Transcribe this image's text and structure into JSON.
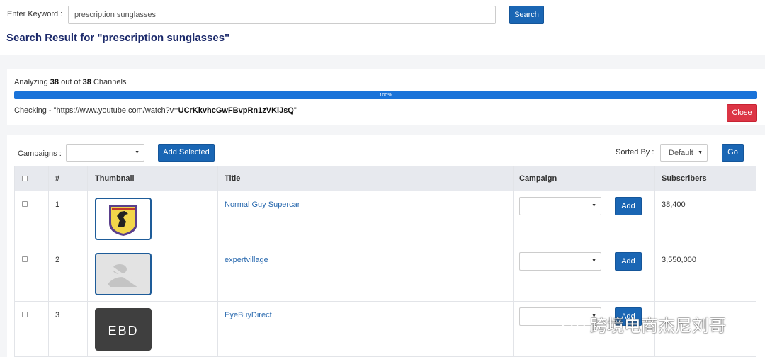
{
  "search": {
    "label": "Enter Keyword :",
    "value": "prescription sunglasses",
    "button": "Search",
    "result_title": "Search Result for \"prescription sunglasses\""
  },
  "progress": {
    "analyzing_prefix": "Analyzing",
    "analyzed": "38",
    "out_of": "out of",
    "total": "38",
    "suffix": "Channels",
    "percent_label": "100%",
    "percent": 100,
    "checking_prefix": "Checking - \"https://www.youtube.com/watch?v=",
    "checking_id": "UCrKkvhcGwFBvpRn1zVKiJsQ",
    "checking_suffix": "\"",
    "close": "Close",
    "bar_color": "#1a73d9",
    "close_color": "#dc3545"
  },
  "toolbar": {
    "campaigns_label": "Campaigns :",
    "campaigns_value": "",
    "add_selected": "Add Selected",
    "sorted_label": "Sorted By :",
    "sort_value": "Default",
    "go": "Go"
  },
  "table": {
    "headers": [
      "#",
      "Thumbnail",
      "Title",
      "Campaign",
      "Subscribers"
    ],
    "add_label": "Add",
    "rows": [
      {
        "num": "1",
        "title": "Normal Guy Supercar",
        "subscribers": "38,400",
        "thumb_icon": "prancing-horse-logo-icon"
      },
      {
        "num": "2",
        "title": "expertvillage",
        "subscribers": "3,550,000",
        "thumb_icon": "default-avatar-icon"
      },
      {
        "num": "3",
        "title": "EyeBuyDirect",
        "subscribers": "",
        "thumb_icon": "ebd-logo-icon",
        "thumb_text": "EBD"
      }
    ]
  },
  "watermark": {
    "text": "跨境电商杰尼刘哥",
    "icon": "wechat-icon"
  },
  "colors": {
    "primary": "#1a66b4",
    "title": "#1c2a6b",
    "link": "#2a6aaf"
  }
}
